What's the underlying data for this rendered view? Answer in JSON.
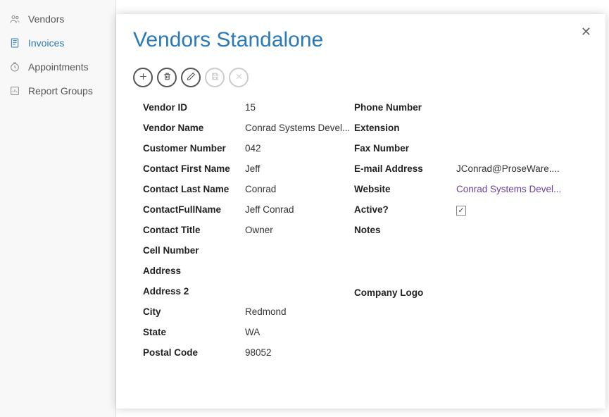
{
  "sidebar": {
    "items": [
      {
        "label": "Vendors",
        "icon": "people-icon"
      },
      {
        "label": "Invoices",
        "icon": "invoice-icon"
      },
      {
        "label": "Appointments",
        "icon": "clock-icon"
      },
      {
        "label": "Report Groups",
        "icon": "report-icon"
      }
    ]
  },
  "modal": {
    "title": "Vendors Standalone",
    "fields_left": {
      "vendor_id": {
        "label": "Vendor ID",
        "value": "15"
      },
      "vendor_name": {
        "label": "Vendor Name",
        "value": "Conrad Systems Devel..."
      },
      "customer_number": {
        "label": "Customer Number",
        "value": "042"
      },
      "contact_first": {
        "label": "Contact First Name",
        "value": "Jeff"
      },
      "contact_last": {
        "label": "Contact Last Name",
        "value": "Conrad"
      },
      "contact_full": {
        "label": "ContactFullName",
        "value": "Jeff Conrad"
      },
      "contact_title": {
        "label": "Contact Title",
        "value": "Owner"
      },
      "cell_number": {
        "label": "Cell Number",
        "value": ""
      },
      "address": {
        "label": "Address",
        "value": ""
      },
      "address2": {
        "label": "Address 2",
        "value": ""
      },
      "city": {
        "label": "City",
        "value": "Redmond"
      },
      "state": {
        "label": "State",
        "value": "WA"
      },
      "postal": {
        "label": "Postal Code",
        "value": "98052"
      }
    },
    "fields_right": {
      "phone": {
        "label": "Phone Number",
        "value": ""
      },
      "extension": {
        "label": "Extension",
        "value": ""
      },
      "fax": {
        "label": "Fax Number",
        "value": ""
      },
      "email": {
        "label": "E-mail Address",
        "value": "JConrad@ProseWare...."
      },
      "website": {
        "label": "Website",
        "value": "Conrad Systems Devel..."
      },
      "active": {
        "label": "Active?",
        "value": "checked"
      },
      "notes": {
        "label": "Notes",
        "value": ""
      },
      "logo": {
        "label": "Company Logo",
        "value": ""
      }
    },
    "checkmark": "✓"
  }
}
